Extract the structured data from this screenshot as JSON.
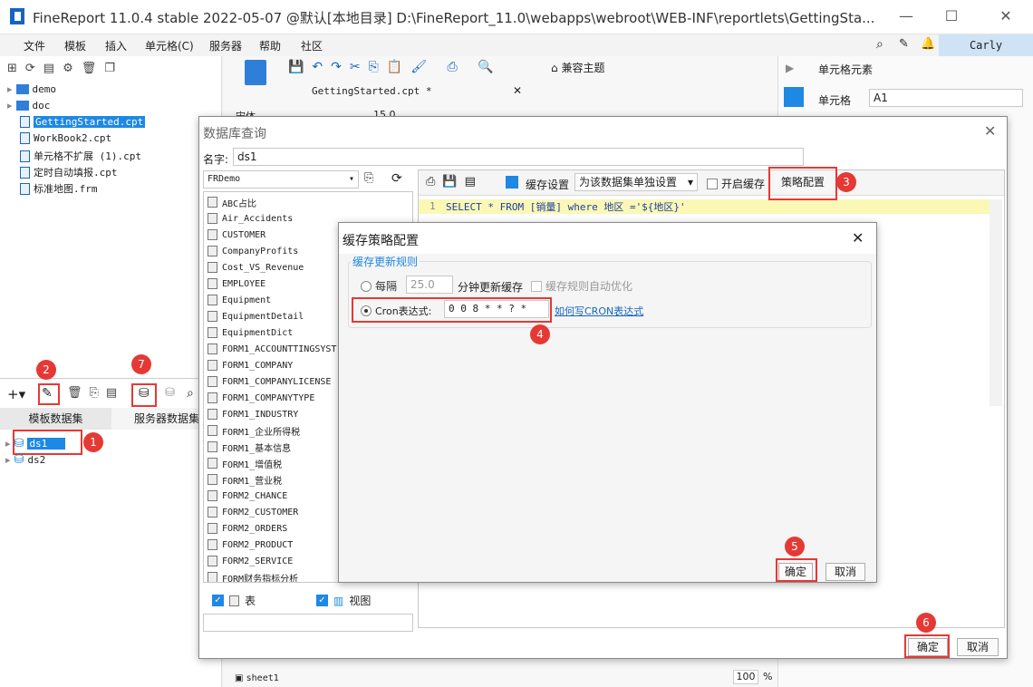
{
  "window": {
    "title": "FineReport 11.0.4 stable 2022-05-07 @默认[本地目录]    D:\\FineReport_11.0\\webapps\\webroot\\WEB-INF\\reportlets\\GettingSta...",
    "min": "—",
    "max": "☐",
    "close": "✕"
  },
  "menu": [
    "文件",
    "模板",
    "插入",
    "单元格(C)",
    "服务器",
    "帮助",
    "社区"
  ],
  "user": "Carly",
  "tree": [
    {
      "label": "demo",
      "type": "folder"
    },
    {
      "label": "doc",
      "type": "folder"
    },
    {
      "label": "GettingStarted.cpt",
      "type": "file",
      "selected": true
    },
    {
      "label": "WorkBook2.cpt",
      "type": "file"
    },
    {
      "label": "单元格不扩展 (1).cpt",
      "type": "file"
    },
    {
      "label": "定时自动填报.cpt",
      "type": "file"
    },
    {
      "label": "标准地图.frm",
      "type": "file"
    }
  ],
  "dataset_tabs": [
    "模板数据集",
    "服务器数据集"
  ],
  "datasets": [
    "ds1",
    "ds2"
  ],
  "editor_tab": "GettingStarted.cpt *",
  "toolbar": {
    "compat": "兼容主题",
    "font": "宋体",
    "size": "15.0"
  },
  "right_panel": {
    "title": "单元格元素",
    "cell_label": "单元格",
    "cell_value": "A1"
  },
  "db_dialog": {
    "title": "数据库查询",
    "name_label": "名字:",
    "name_value": "ds1",
    "connection": "FRDemo",
    "tables": [
      "ABC占比",
      "Air_Accidents",
      "CUSTOMER",
      "CompanyProfits",
      "Cost_VS_Revenue",
      "EMPLOYEE",
      "Equipment",
      "EquipmentDetail",
      "EquipmentDict",
      "FORM1_ACCOUNTTINGSYST",
      "FORM1_COMPANY",
      "FORM1_COMPANYLICENSE",
      "FORM1_COMPANYTYPE",
      "FORM1_INDUSTRY",
      "FORM1_企业所得税",
      "FORM1_基本信息",
      "FORM1_增值税",
      "FORM1_营业税",
      "FORM2_CHANCE",
      "FORM2_CUSTOMER",
      "FORM2_ORDERS",
      "FORM2_PRODUCT",
      "FORM2_SERVICE",
      "FORM财务指标分析"
    ],
    "check_table": "表",
    "check_view": "视图",
    "cache_label": "缓存设置",
    "cache_option": "为该数据集单独设置",
    "enable_cache": "开启缓存",
    "strategy_button": "策略配置",
    "sql_line_no": "1",
    "sql": "SELECT * FROM [销量] where 地区 ='${地区}'",
    "ok": "确定",
    "cancel": "取消"
  },
  "cache_dialog": {
    "title": "缓存策略配置",
    "group": "缓存更新规则",
    "every_label": "每隔",
    "every_value": "25.0",
    "every_suffix": "分钟更新缓存",
    "auto_opt": "缓存规则自动优化",
    "cron_label": "Cron表达式:",
    "cron_value": "0 0 8 * * ? *",
    "cron_link": "如何写CRON表达式",
    "ok": "确定",
    "cancel": "取消"
  },
  "badges": [
    "1",
    "2",
    "3",
    "4",
    "5",
    "6",
    "7"
  ],
  "bottom": {
    "sheet": "sheet1",
    "zoom": "100",
    "pct": "%"
  },
  "colors": {
    "accent": "#1e88e5",
    "badge": "#e53935",
    "sql_bg": "#fbf7b5"
  }
}
